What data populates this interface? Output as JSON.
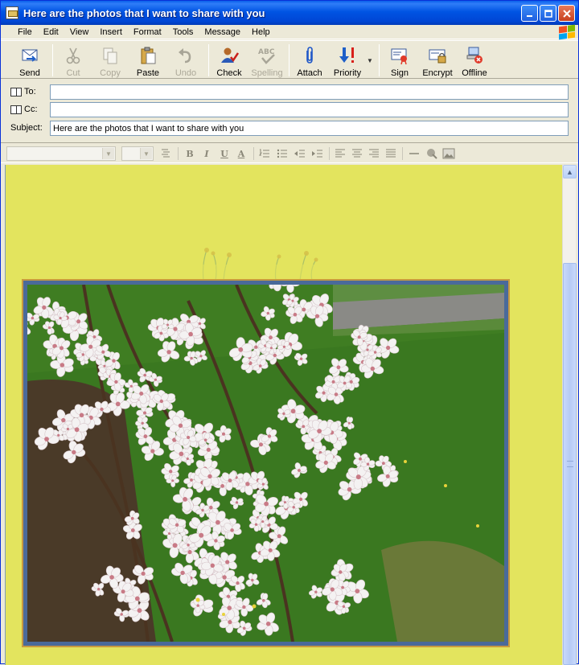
{
  "window": {
    "title": "Here are the photos that I want to share with you"
  },
  "menu": [
    "File",
    "Edit",
    "View",
    "Insert",
    "Format",
    "Tools",
    "Message",
    "Help"
  ],
  "toolbar": {
    "send": "Send",
    "cut": "Cut",
    "copy": "Copy",
    "paste": "Paste",
    "undo": "Undo",
    "check": "Check",
    "spelling": "Spelling",
    "attach": "Attach",
    "priority": "Priority",
    "sign": "Sign",
    "encrypt": "Encrypt",
    "offline": "Offline"
  },
  "header": {
    "to_label": "To:",
    "to_value": "",
    "cc_label": "Cc:",
    "cc_value": "",
    "subject_label": "Subject:",
    "subject_value": "Here are the photos that I want to share with you"
  },
  "format": {
    "font_name": "",
    "font_size": ""
  },
  "editor": {
    "background_color": "#E3E45E",
    "frame_color": "#C89A40"
  }
}
